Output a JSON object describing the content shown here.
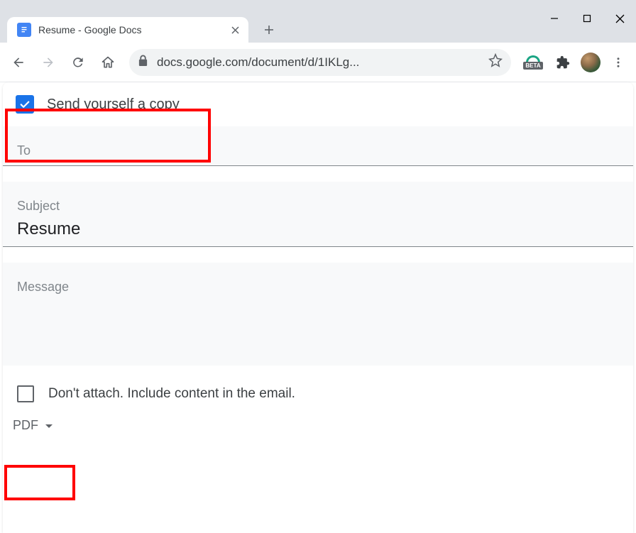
{
  "browser": {
    "tab_title": "Resume - Google Docs",
    "url": "docs.google.com/document/d/1IKLg...",
    "beta_label": "BETA"
  },
  "dialog": {
    "send_copy_label": "Send yourself a copy",
    "to_label": "To",
    "subject_label": "Subject",
    "subject_value": "Resume",
    "message_label": "Message",
    "attach_label": "Don't attach. Include content in the email.",
    "format_label": "PDF"
  }
}
